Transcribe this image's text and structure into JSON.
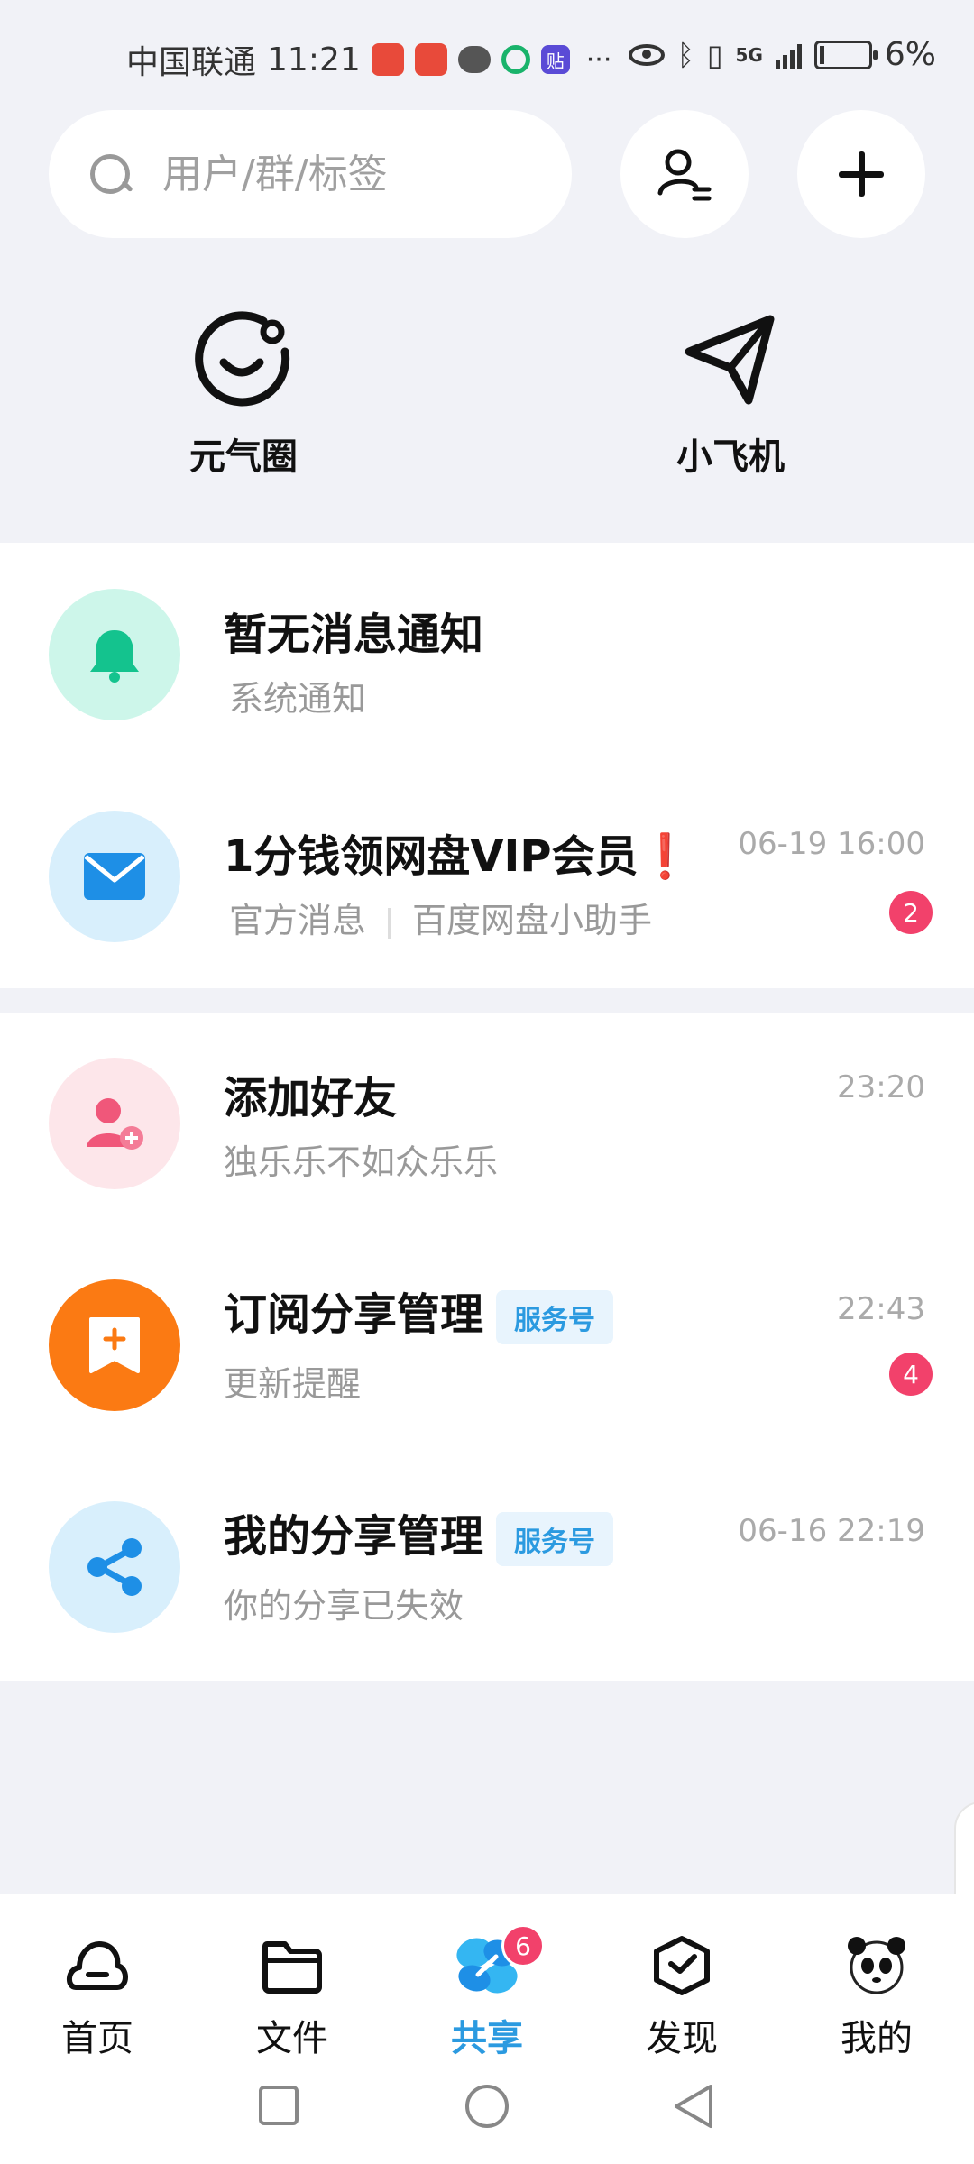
{
  "status_bar": {
    "carrier": "中国联通",
    "time": "11:21",
    "tie_icon": "贴",
    "more": "···",
    "network": "5G",
    "battery": "6%"
  },
  "search": {
    "placeholder": "用户/群/标签"
  },
  "quick_entries": [
    {
      "label": "元气圈",
      "icon": "smile-circle-icon"
    },
    {
      "label": "小飞机",
      "icon": "paper-plane-icon"
    }
  ],
  "messages_top": [
    {
      "title": "暂无消息通知",
      "subtitle": "系统通知",
      "icon": "bell-icon",
      "avatar_bg": "#cdf6ea"
    },
    {
      "title": "1分钱领网盘VIP会员",
      "title_emoji": "❗",
      "subtitle_a": "官方消息",
      "subtitle_b": "百度网盘小助手",
      "time": "06-19 16:00",
      "badge": "2",
      "icon": "mail-icon",
      "avatar_bg": "#d8effc"
    }
  ],
  "messages_bottom": [
    {
      "title": "添加好友",
      "subtitle": "独乐乐不如众乐乐",
      "time": "23:20",
      "icon": "add-friend-icon",
      "avatar_bg": "#fde6ea"
    },
    {
      "title": "订阅分享管理",
      "tag": "服务号",
      "subtitle": "更新提醒",
      "time": "22:43",
      "badge": "4",
      "icon": "bookmark-plus-icon",
      "avatar_bg": "#fb7a13"
    },
    {
      "title": "我的分享管理",
      "tag": "服务号",
      "subtitle": "你的分享已失效",
      "time": "06-16 22:19",
      "icon": "share-icon",
      "avatar_bg": "#d8effc"
    }
  ],
  "bottom_nav": [
    {
      "label": "首页",
      "icon": "cloud-icon"
    },
    {
      "label": "文件",
      "icon": "folder-icon"
    },
    {
      "label": "共享",
      "icon": "share-butterfly-icon",
      "badge": "6",
      "active": true
    },
    {
      "label": "发现",
      "icon": "discover-box-icon"
    },
    {
      "label": "我的",
      "icon": "panda-avatar-icon"
    }
  ],
  "colors": {
    "accent": "#2b9ae0",
    "badge": "#f2416b",
    "background": "#f1f2f7"
  }
}
